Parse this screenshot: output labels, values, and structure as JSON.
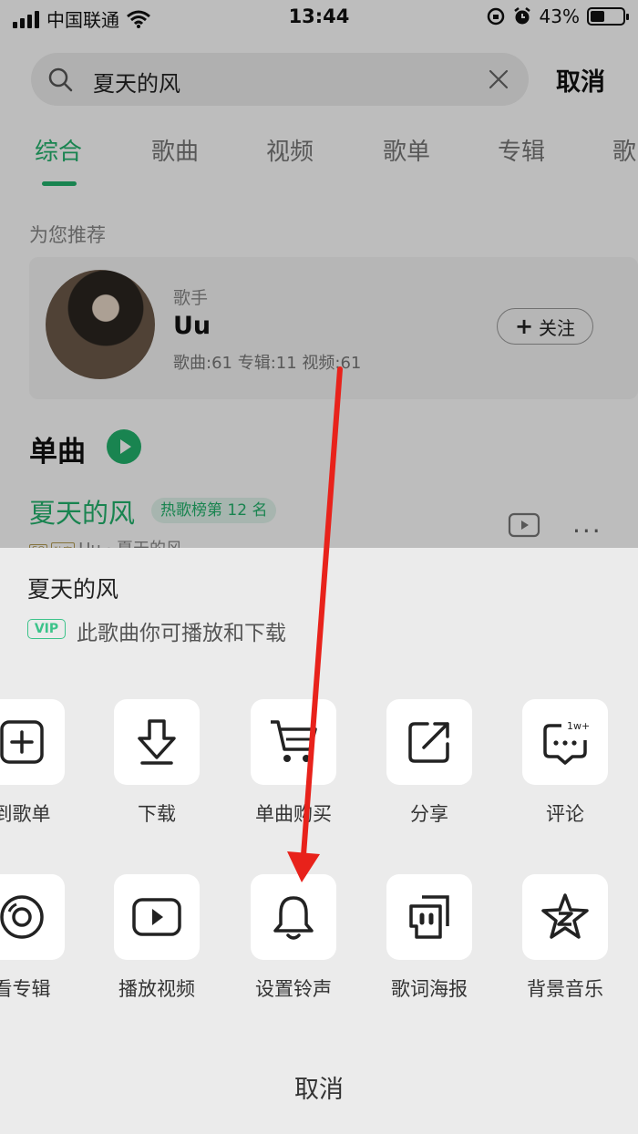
{
  "status_bar": {
    "carrier": "中国联通",
    "time": "13:44",
    "battery": "43%",
    "battery_level": 0.43
  },
  "search": {
    "query": "夏天的风",
    "cancel_label": "取消"
  },
  "tabs": [
    {
      "label": "综合",
      "active": true
    },
    {
      "label": "歌曲"
    },
    {
      "label": "视频"
    },
    {
      "label": "歌单"
    },
    {
      "label": "专辑"
    },
    {
      "label": "歌"
    }
  ],
  "recommend": {
    "section_label": "为您推荐",
    "artist_type": "歌手",
    "artist_name": "Uu",
    "artist_stats": "歌曲:61 专辑:11 视频:61",
    "follow_label": "关注"
  },
  "singles": {
    "title": "单曲",
    "song_title": "夏天的风",
    "rank_badge": "热歌榜第 12 名",
    "song_sub": "Uu · 夏天的风",
    "more": "···"
  },
  "sheet": {
    "song_title": "夏天的风",
    "vip_badge": "VIP",
    "vip_text": "此歌曲你可播放和下载",
    "actions_row1": [
      {
        "label": "到歌单",
        "icon": "add-to-playlist-icon"
      },
      {
        "label": "下载",
        "icon": "download-icon"
      },
      {
        "label": "单曲购买",
        "icon": "cart-icon"
      },
      {
        "label": "分享",
        "icon": "share-icon"
      },
      {
        "label": "评论",
        "icon": "comment-icon",
        "count_badge": "1w+"
      }
    ],
    "actions_row2": [
      {
        "label": "看专辑",
        "icon": "album-icon"
      },
      {
        "label": "播放视频",
        "icon": "play-video-icon"
      },
      {
        "label": "设置铃声",
        "icon": "bell-icon"
      },
      {
        "label": "歌词海报",
        "icon": "lyrics-poster-icon"
      },
      {
        "label": "背景音乐",
        "icon": "background-music-icon"
      }
    ],
    "cancel_label": "取消"
  },
  "colors": {
    "accent_green": "#22b26c",
    "arrow_red": "#e8221b",
    "sheet_bg": "#ebebeb"
  }
}
